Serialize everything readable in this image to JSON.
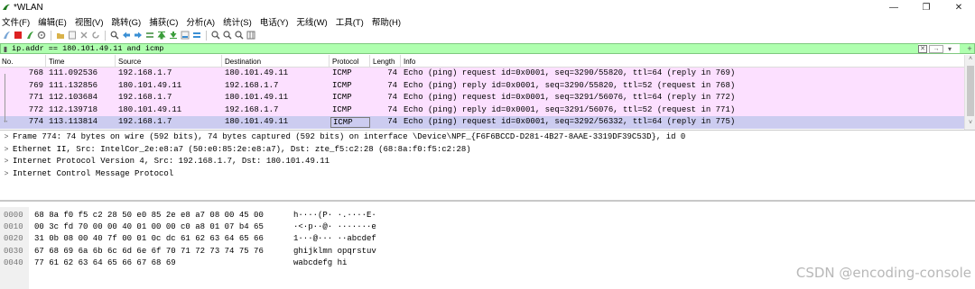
{
  "window": {
    "title": "*WLAN",
    "minimize": "—",
    "maximize": "❐",
    "close": "✕"
  },
  "menu": [
    "文件(F)",
    "编辑(E)",
    "视图(V)",
    "跳转(G)",
    "捕获(C)",
    "分析(A)",
    "统计(S)",
    "电话(Y)",
    "无线(W)",
    "工具(T)",
    "帮助(H)"
  ],
  "filter": {
    "value": "ip.addr == 180.101.49.11 and icmp"
  },
  "packet_list": {
    "columns": [
      "No.",
      "Time",
      "Source",
      "Destination",
      "Protocol",
      "Length",
      "Info"
    ],
    "rows": [
      {
        "no": "768",
        "time": "111.092536",
        "src": "192.168.1.7",
        "dst": "180.101.49.11",
        "proto": "ICMP",
        "len": "74",
        "info": "Echo (ping) request  id=0x0001, seq=3290/55820, ttl=64 (reply in 769)",
        "bg": "#fce0ff"
      },
      {
        "no": "769",
        "time": "111.132856",
        "src": "180.101.49.11",
        "dst": "192.168.1.7",
        "proto": "ICMP",
        "len": "74",
        "info": "Echo (ping) reply    id=0x0001, seq=3290/55820, ttl=52 (request in 768)",
        "bg": "#fce0ff"
      },
      {
        "no": "771",
        "time": "112.103684",
        "src": "192.168.1.7",
        "dst": "180.101.49.11",
        "proto": "ICMP",
        "len": "74",
        "info": "Echo (ping) request  id=0x0001, seq=3291/56076, ttl=64 (reply in 772)",
        "bg": "#fce0ff"
      },
      {
        "no": "772",
        "time": "112.139718",
        "src": "180.101.49.11",
        "dst": "192.168.1.7",
        "proto": "ICMP",
        "len": "74",
        "info": "Echo (ping) reply    id=0x0001, seq=3291/56076, ttl=52 (request in 771)",
        "bg": "#fce0ff"
      },
      {
        "no": "774",
        "time": "113.113814",
        "src": "192.168.1.7",
        "dst": "180.101.49.11",
        "proto": "ICMP",
        "len": "74",
        "info": "Echo (ping) request  id=0x0001, seq=3292/56332, ttl=64 (reply in 775)",
        "bg": "#ccccf0"
      }
    ]
  },
  "details": [
    "Frame 774: 74 bytes on wire (592 bits), 74 bytes captured (592 bits) on interface \\Device\\NPF_{F6F6BCCD-D281-4B27-8AAE-3319DF39C53D}, id 0",
    "Ethernet II, Src: IntelCor_2e:e8:a7 (50:e0:85:2e:e8:a7), Dst: zte_f5:c2:28 (68:8a:f0:f5:c2:28)",
    "Internet Protocol Version 4, Src: 192.168.1.7, Dst: 180.101.49.11",
    "Internet Control Message Protocol"
  ],
  "hex": [
    {
      "offset": "0000",
      "bytes": "68 8a f0 f5 c2 28 50 e0  85 2e e8 a7 08 00 45 00",
      "ascii": "h····(P· ·.····E·"
    },
    {
      "offset": "0010",
      "bytes": "00 3c fd 70 00 00 40 01  00 00 c0 a8 01 07 b4 65",
      "ascii": "·<·p··@· ·······e"
    },
    {
      "offset": "0020",
      "bytes": "31 0b 08 00 40 7f 00 01  0c dc 61 62 63 64 65 66",
      "ascii": "1···@··· ··abcdef"
    },
    {
      "offset": "0030",
      "bytes": "67 68 69 6a 6b 6c 6d 6e  6f 70 71 72 73 74 75 76",
      "ascii": "ghijklmn opqrstuv"
    },
    {
      "offset": "0040",
      "bytes": "77 61 62 63 64 65 66 67  68 69",
      "ascii": "wabcdefg hi"
    }
  ],
  "watermark": "CSDN @encoding-console"
}
